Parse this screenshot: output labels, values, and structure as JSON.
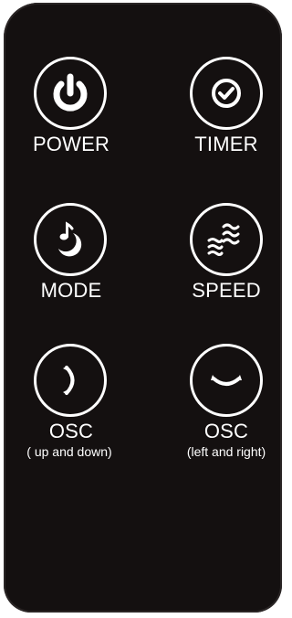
{
  "remote": {
    "body_color": "#141010",
    "accent_color": "#ffffff",
    "buttons": {
      "power": {
        "label": "POWER",
        "icon": "power-icon"
      },
      "timer": {
        "label": "TIMER",
        "icon": "timer-check-icon"
      },
      "mode": {
        "label": "MODE",
        "icon": "moon-note-icon"
      },
      "speed": {
        "label": "SPEED",
        "icon": "wind-waves-icon"
      },
      "osc_vertical": {
        "label": "OSC",
        "sublabel": "( up and down)",
        "icon": "vertical-arc-icon"
      },
      "osc_horizontal": {
        "label": "OSC",
        "sublabel": "(left and right)",
        "icon": "horizontal-arc-icon"
      }
    }
  }
}
